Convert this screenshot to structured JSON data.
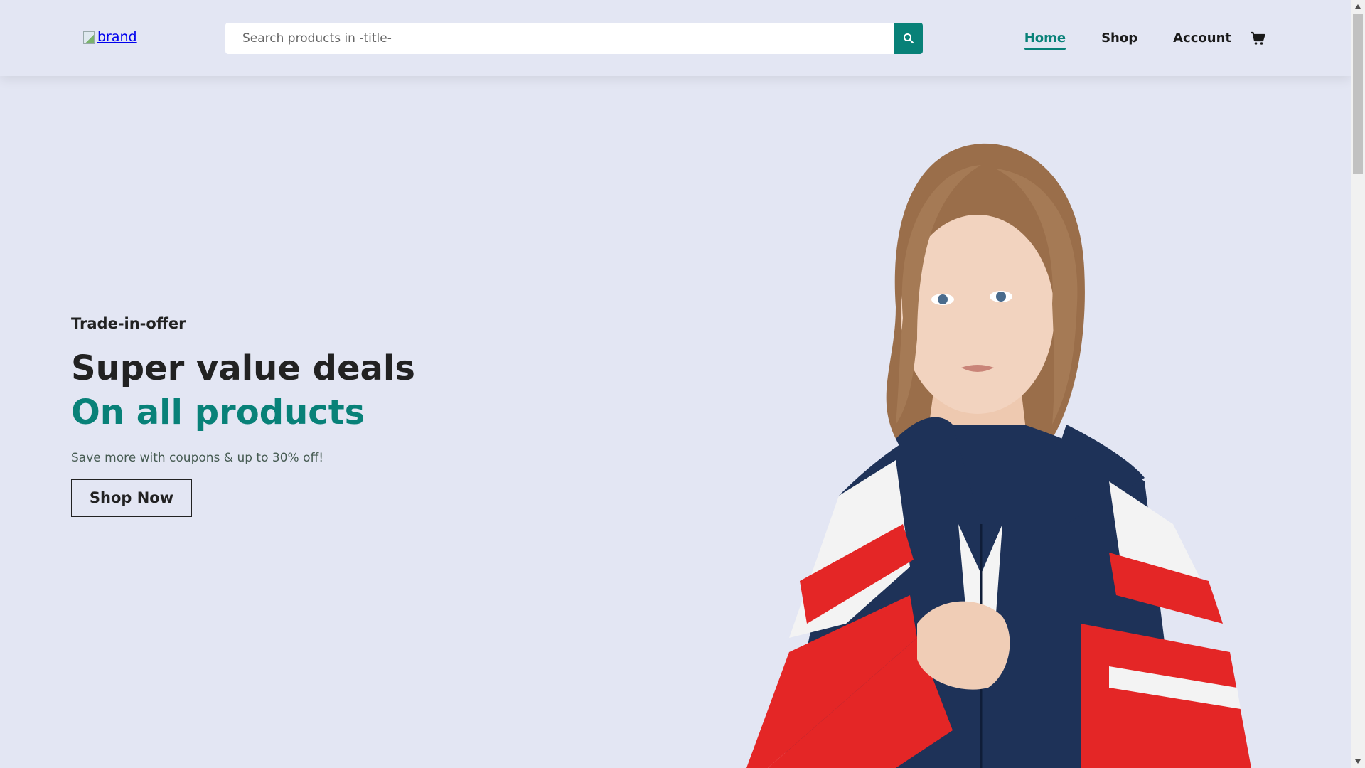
{
  "header": {
    "brand_alt": "brand",
    "search": {
      "placeholder": "Search products in -title-"
    },
    "nav": {
      "home": "Home",
      "shop": "Shop",
      "account": "Account"
    },
    "cart_icon": "cart-icon"
  },
  "hero": {
    "offer": "Trade-in-offer",
    "headline": "Super value deals",
    "headline2": "On all products",
    "subtext": "Save more with coupons & up to 30% off!",
    "button": "Shop Now"
  },
  "colors": {
    "accent": "#088178",
    "background": "#e3e6f3",
    "text": "#222222"
  }
}
